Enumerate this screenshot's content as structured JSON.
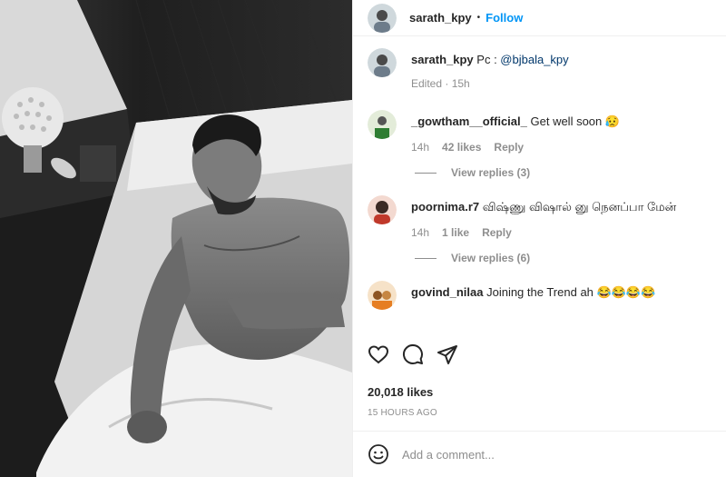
{
  "post": {
    "photo_alt": "",
    "author": {
      "username": "sarath_kpy",
      "follow_label": "Follow",
      "separator": "•"
    },
    "caption": {
      "username": "sarath_kpy",
      "text_prefix": "Pc : ",
      "mention": "@bjbala_kpy",
      "meta": "Edited · 15h"
    },
    "comments": [
      {
        "username": "_gowtham__official_",
        "text": "Get well soon 😥",
        "time": "14h",
        "likes": "42 likes",
        "reply_label": "Reply",
        "view_replies": "View replies (3)"
      },
      {
        "username": "poornima.r7",
        "text": "விஷ்ணு விஷால் னு நெனப்பா மேன்",
        "time": "14h",
        "likes": "1 like",
        "reply_label": "Reply",
        "view_replies": "View replies (6)"
      },
      {
        "username": "govind_nilaa",
        "text": "Joining the Trend ah 😂😂😂😂"
      }
    ],
    "actions": {
      "like_icon": "heart-icon",
      "comment_icon": "comment-icon",
      "share_icon": "share-icon"
    },
    "likes_count": "20,018 likes",
    "posted_ago": "15 HOURS AGO",
    "add_comment": {
      "emoji_icon": "emoji-icon",
      "placeholder": "Add a comment..."
    }
  }
}
